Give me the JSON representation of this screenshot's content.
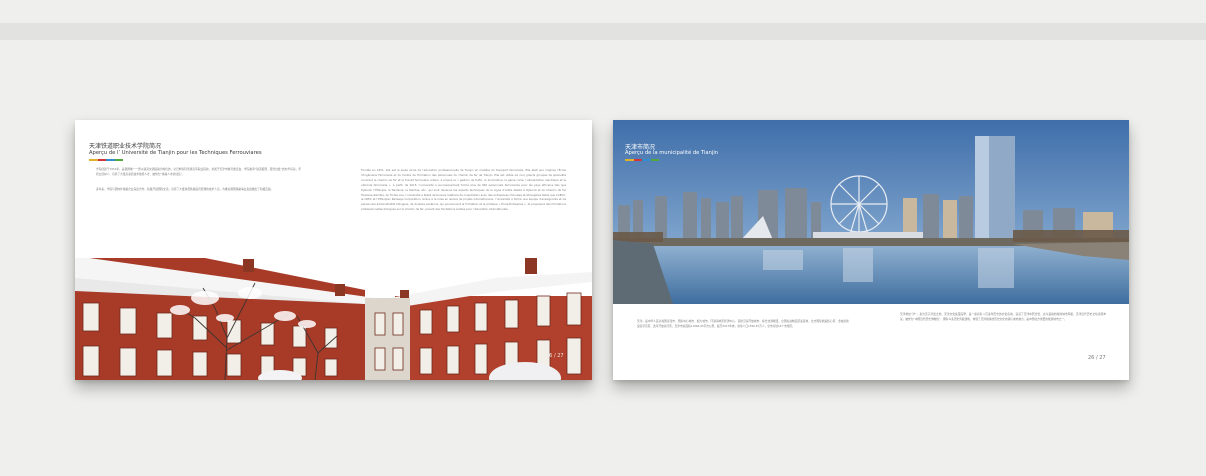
{
  "colors": {
    "background": "#efefed",
    "page": "#ffffff",
    "accent": [
      "#e0b12a",
      "#d2343c",
      "#2f8fcf",
      "#54a83b"
    ],
    "sky": "#3f6ea9",
    "brick": "#a83a28"
  },
  "left_page": {
    "title_cn": "天津铁道职业技术学院简况",
    "title_fr": "Aperçu de l’ Université de Tianjin pour les Techniques Ferrouviares",
    "body_left": [
      "学院创建于1951年，是我国唯一一所以铁道交通运输为特色的，全日制专科普通高等职业院校，隶属于天津市教育委员会，学院秉承“铁道报国、服务社会”的办学宗旨，坚持立德树人，培养了大批高素质技术技能人才，被誉为“铁路人才的摇篮”。",
      "多年来，学院与国内外铁路企业深度合作，积极开展国际交流，培养了大批熟悉铁路运营管理的技术人员，为推动我国铁路事业发展做出了积极贡献。"
    ],
    "body_right": "Fondée en 1951, elle est la seule école de l’éducation professionnelle de Tianjin en matière du transport ferroviaire. Elle était aux origines l’École d’Ingénierie Ferroviaire et du Centre de Formation des personnels du chemin de fer de Tianjin. Elle est dotée de cinq grands groupes de spécialité couvrant le chemin de fer et le transit ferroviaire urbain, à propos la « gestion de trafic, la locomotive, la génie civile, l’alimentation électrique et le véhicule ferroviaire ». À partir de 2015, l’université a successivement formé plus de 940 personnels ferroviaires pour les pays africains tels que Djibouti, l’Éthiopie, la Tanzanie, la Zambie, etc., qui sont devenus les experts techniques de la Ligne d’Addis Abeba à Djibouti et du Chemin de fer Tanzanie-Zambie. Au fil des ans, l’université a établi de bonnes relations de coopération avec des entreprises chinoises et étrangères telles que CCECC, la CREC et l’Ethiopian Railways Corporation. Grâce à la mise en œuvre de projets internationaux, l’université a formé une équipe d’enseignants et de personnels administratifs bilingues, de doubles positions, qui poursuivent la formation et la pratique « École-Entreprise », et proposent des formations professionnelles bilingues sur le chemin de fer, posant des fondations solides pour l’éducation internationale.",
    "page_number": "26 / 27"
  },
  "right_page": {
    "title_cn": "天津市简况",
    "title_fr": "Aperçu de la municipalité de Tianjin",
    "body_left": "天津，是中华人民共和国直辖市、国家中心城市、超大城市、环渤海地区经济中心、首批沿海开放城市、综合交通枢纽，全国先进制造研发基地、北方国际航运核心区、金融创新运营示范区、改革开放先行区。天津市总面积11966.45平方公里，截至2017年末，常住人口1556.87万人，全市共辖16个市辖区。",
    "body_right": "天津地处“津”，素为天子津渡之地，天津文化底蕴深厚，是一座具有八百多年历史的文化名城，造就了天津中西合璧、古今兼容的独特城市风貌，天津近代历史文化资源丰富，被誉为“中国近代历史博物馆”，拥有众多历史风貌建筑，体现了天津独特的历史文化内涵与城市魅力，是中国北方重要的旅游城市之一。",
    "page_number": "26 / 27"
  }
}
